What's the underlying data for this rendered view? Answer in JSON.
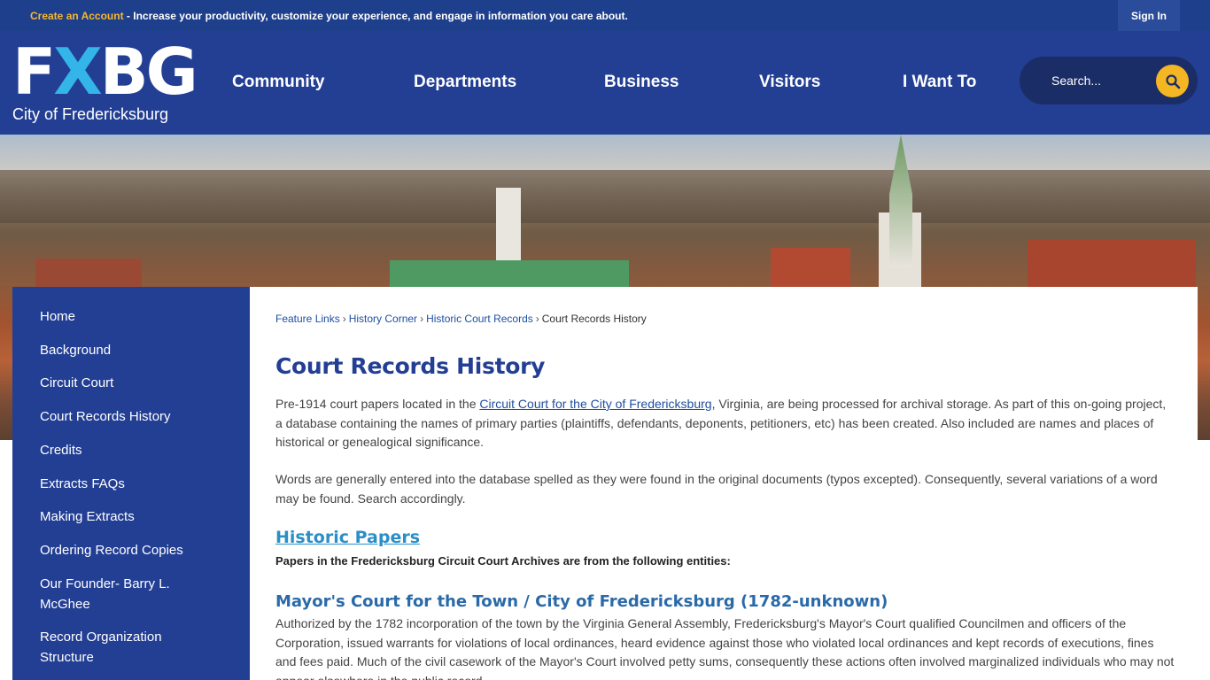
{
  "topbar": {
    "create_account_link": "Create an Account",
    "message": " - Increase your productivity, customize your experience, and engage in information you care about.",
    "sign_in": "Sign In"
  },
  "header": {
    "logo_mark": "FXBG",
    "logo_city": "City of Fredericksburg",
    "nav": [
      "Community",
      "Departments",
      "Business",
      "Visitors",
      "I Want To"
    ],
    "search_placeholder": "Search..."
  },
  "sidebar": {
    "items": [
      {
        "label": "Home"
      },
      {
        "label": "Background"
      },
      {
        "label": "Circuit Court"
      },
      {
        "label": "Court Records History"
      },
      {
        "label": "Credits"
      },
      {
        "label": "Extracts FAQs"
      },
      {
        "label": "Making Extracts"
      },
      {
        "label": "Ordering Record Copies"
      },
      {
        "label": "Our Founder- Barry L. McGhee"
      },
      {
        "label": "Record Organization Structure"
      }
    ]
  },
  "content": {
    "breadcrumb": [
      "Feature Links",
      "History Corner",
      "Historic Court Records",
      "Court Records History"
    ],
    "breadcrumb_sep": "›",
    "title": "Court Records History",
    "para1_before": "Pre-1914 court papers located in the ",
    "para1_link": "Circuit Court for the City of Fredericksburg",
    "para1_after": ", Virginia, are being processed for archival storage. As part of this on-going project, a database containing the names of primary parties (plaintiffs, defendants, deponents, petitioners, etc) has been created. Also included are names and places of historical or genealogical significance.",
    "para2": "Words are generally entered into the database spelled as they were found in the original documents (typos excepted). Consequently, several variations of a word may be found. Search accordingly.",
    "section_link": "Historic Papers",
    "section_intro": "Papers in the Fredericksburg Circuit Court Archives are from the following entities:",
    "subhead": "Mayor's Court for the Town / City of Fredericksburg (1782-unknown)",
    "para3": "Authorized by the 1782 incorporation of the town by the Virginia General Assembly, Fredericksburg's Mayor's Court qualified Councilmen and officers of the Corporation, issued warrants for violations of local ordinances, heard evidence against those who violated local ordinances and kept records of executions, fines and fees paid. Much of the civil casework of the Mayor's Court involved petty sums, consequently these actions often involved marginalized individuals who may not appear elsewhere in the public record."
  },
  "colors": {
    "brand_blue": "#233f94",
    "accent_gold": "#f5b623",
    "logo_x_cyan": "#33b5ea",
    "link_blue": "#1e4fa0"
  }
}
